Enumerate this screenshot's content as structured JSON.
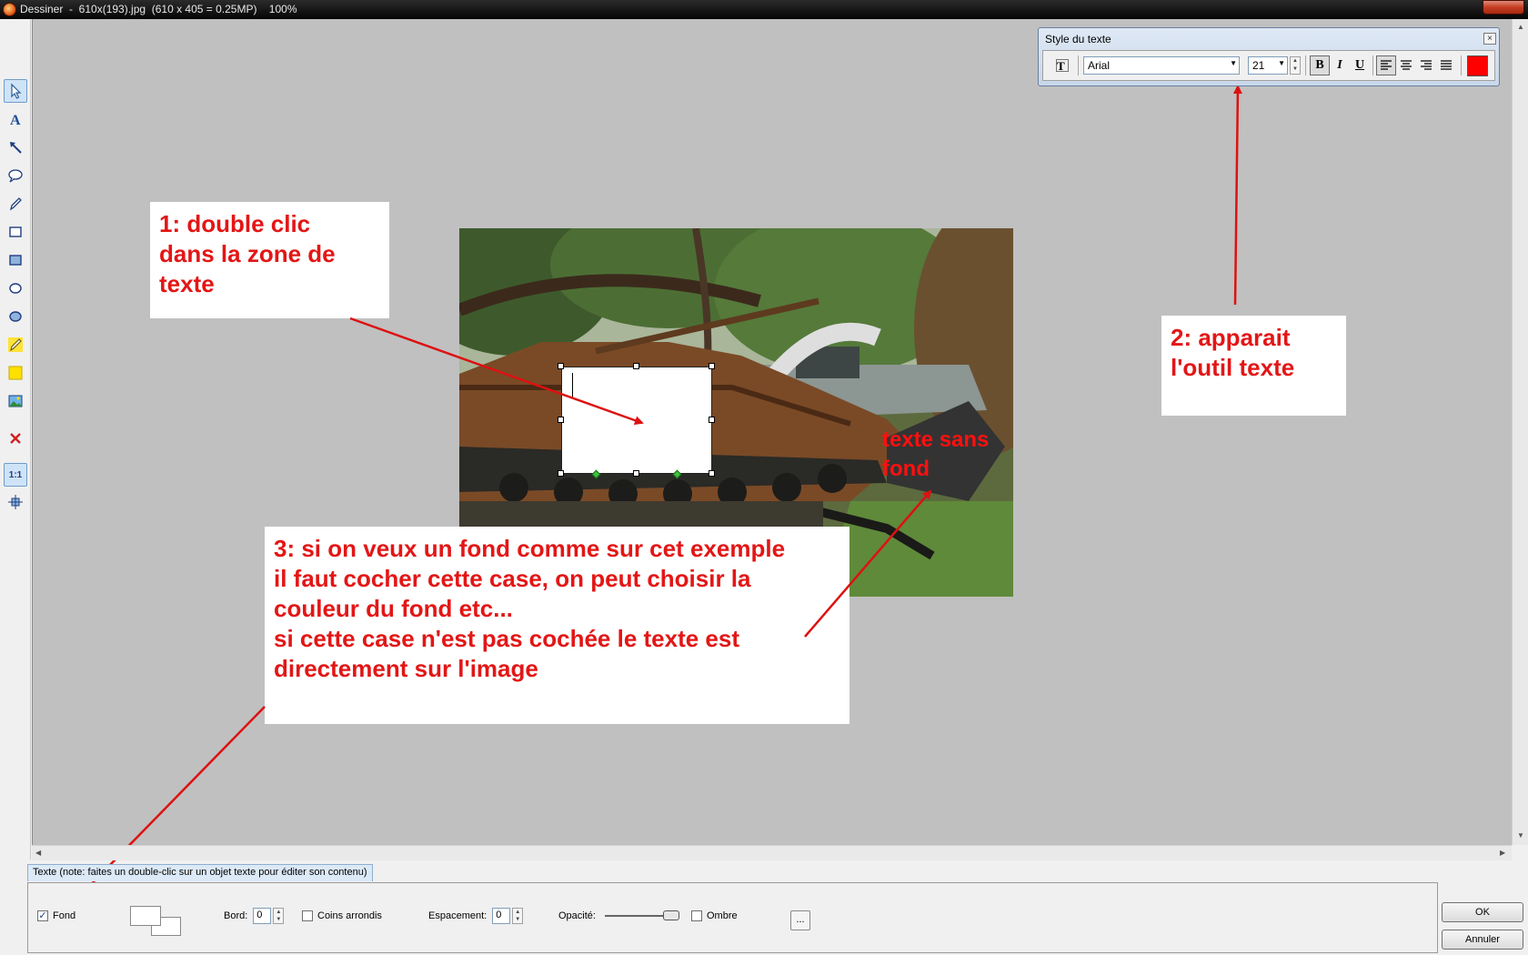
{
  "window": {
    "title": "Dessiner  -  610x(193).jpg  (610 x 405 = 0.25MP)    100%"
  },
  "toolbar": {
    "tools": [
      {
        "name": "select-tool",
        "icon": "pointer-icon"
      },
      {
        "name": "text-tool",
        "icon": "text-a-icon"
      },
      {
        "name": "arrow-tool",
        "icon": "arrow-icon"
      },
      {
        "name": "callout-tool",
        "icon": "speech-bubble-icon"
      },
      {
        "name": "pen-tool",
        "icon": "pen-icon"
      },
      {
        "name": "rectangle-tool",
        "icon": "rectangle-icon"
      },
      {
        "name": "filled-rectangle-tool",
        "icon": "filled-rectangle-icon"
      },
      {
        "name": "ellipse-tool",
        "icon": "ellipse-icon"
      },
      {
        "name": "filled-ellipse-tool",
        "icon": "filled-ellipse-icon"
      },
      {
        "name": "highlighter-tool",
        "icon": "highlighter-icon"
      },
      {
        "name": "highlight-rectangle-tool",
        "icon": "yellow-square-icon"
      },
      {
        "name": "image-tool",
        "icon": "picture-icon"
      },
      {
        "name": "delete-tool",
        "icon": "red-x-icon"
      },
      {
        "name": "actual-size-tool",
        "icon": "one-to-one-icon"
      },
      {
        "name": "fit-tool",
        "icon": "fit-window-icon"
      }
    ],
    "actual_size_label": "1:1"
  },
  "text_style_palette": {
    "title": "Style du texte",
    "close_glyph": "×",
    "font": "Arial",
    "size": "21",
    "bold_label": "B",
    "italic_label": "I",
    "underline_label": "U",
    "text_color": "#ff0000"
  },
  "canvas": {
    "overlay_text": "texte sans fond",
    "overlay_color": "#ff1010"
  },
  "annotations": {
    "note1": "1: double clic\ndans la zone de\ntexte",
    "note2": "2: apparait\nl'outil texte",
    "note3": "3: si on veux un fond comme sur cet exemple\nil faut cocher cette case, on peut choisir la\ncouleur du fond etc...\nsi cette case n'est pas cochée le texte est\ndirectement sur l'image",
    "text_color": "#e31616",
    "arrow_color": "#dd1111"
  },
  "bottom_panel": {
    "tab_label": "Texte (note: faites un double-clic sur un objet texte pour éditer son contenu)",
    "fond_label": "Fond",
    "fond_checked": true,
    "bord_label": "Bord:",
    "bord_value": "0",
    "coins_label": "Coins arrondis",
    "espacement_label": "Espacement:",
    "espacement_value": "0",
    "opacite_label": "Opacité:",
    "opacite_value": 1.0,
    "ombre_label": "Ombre",
    "more_label": "..."
  },
  "buttons": {
    "ok": "OK",
    "cancel": "Annuler"
  }
}
